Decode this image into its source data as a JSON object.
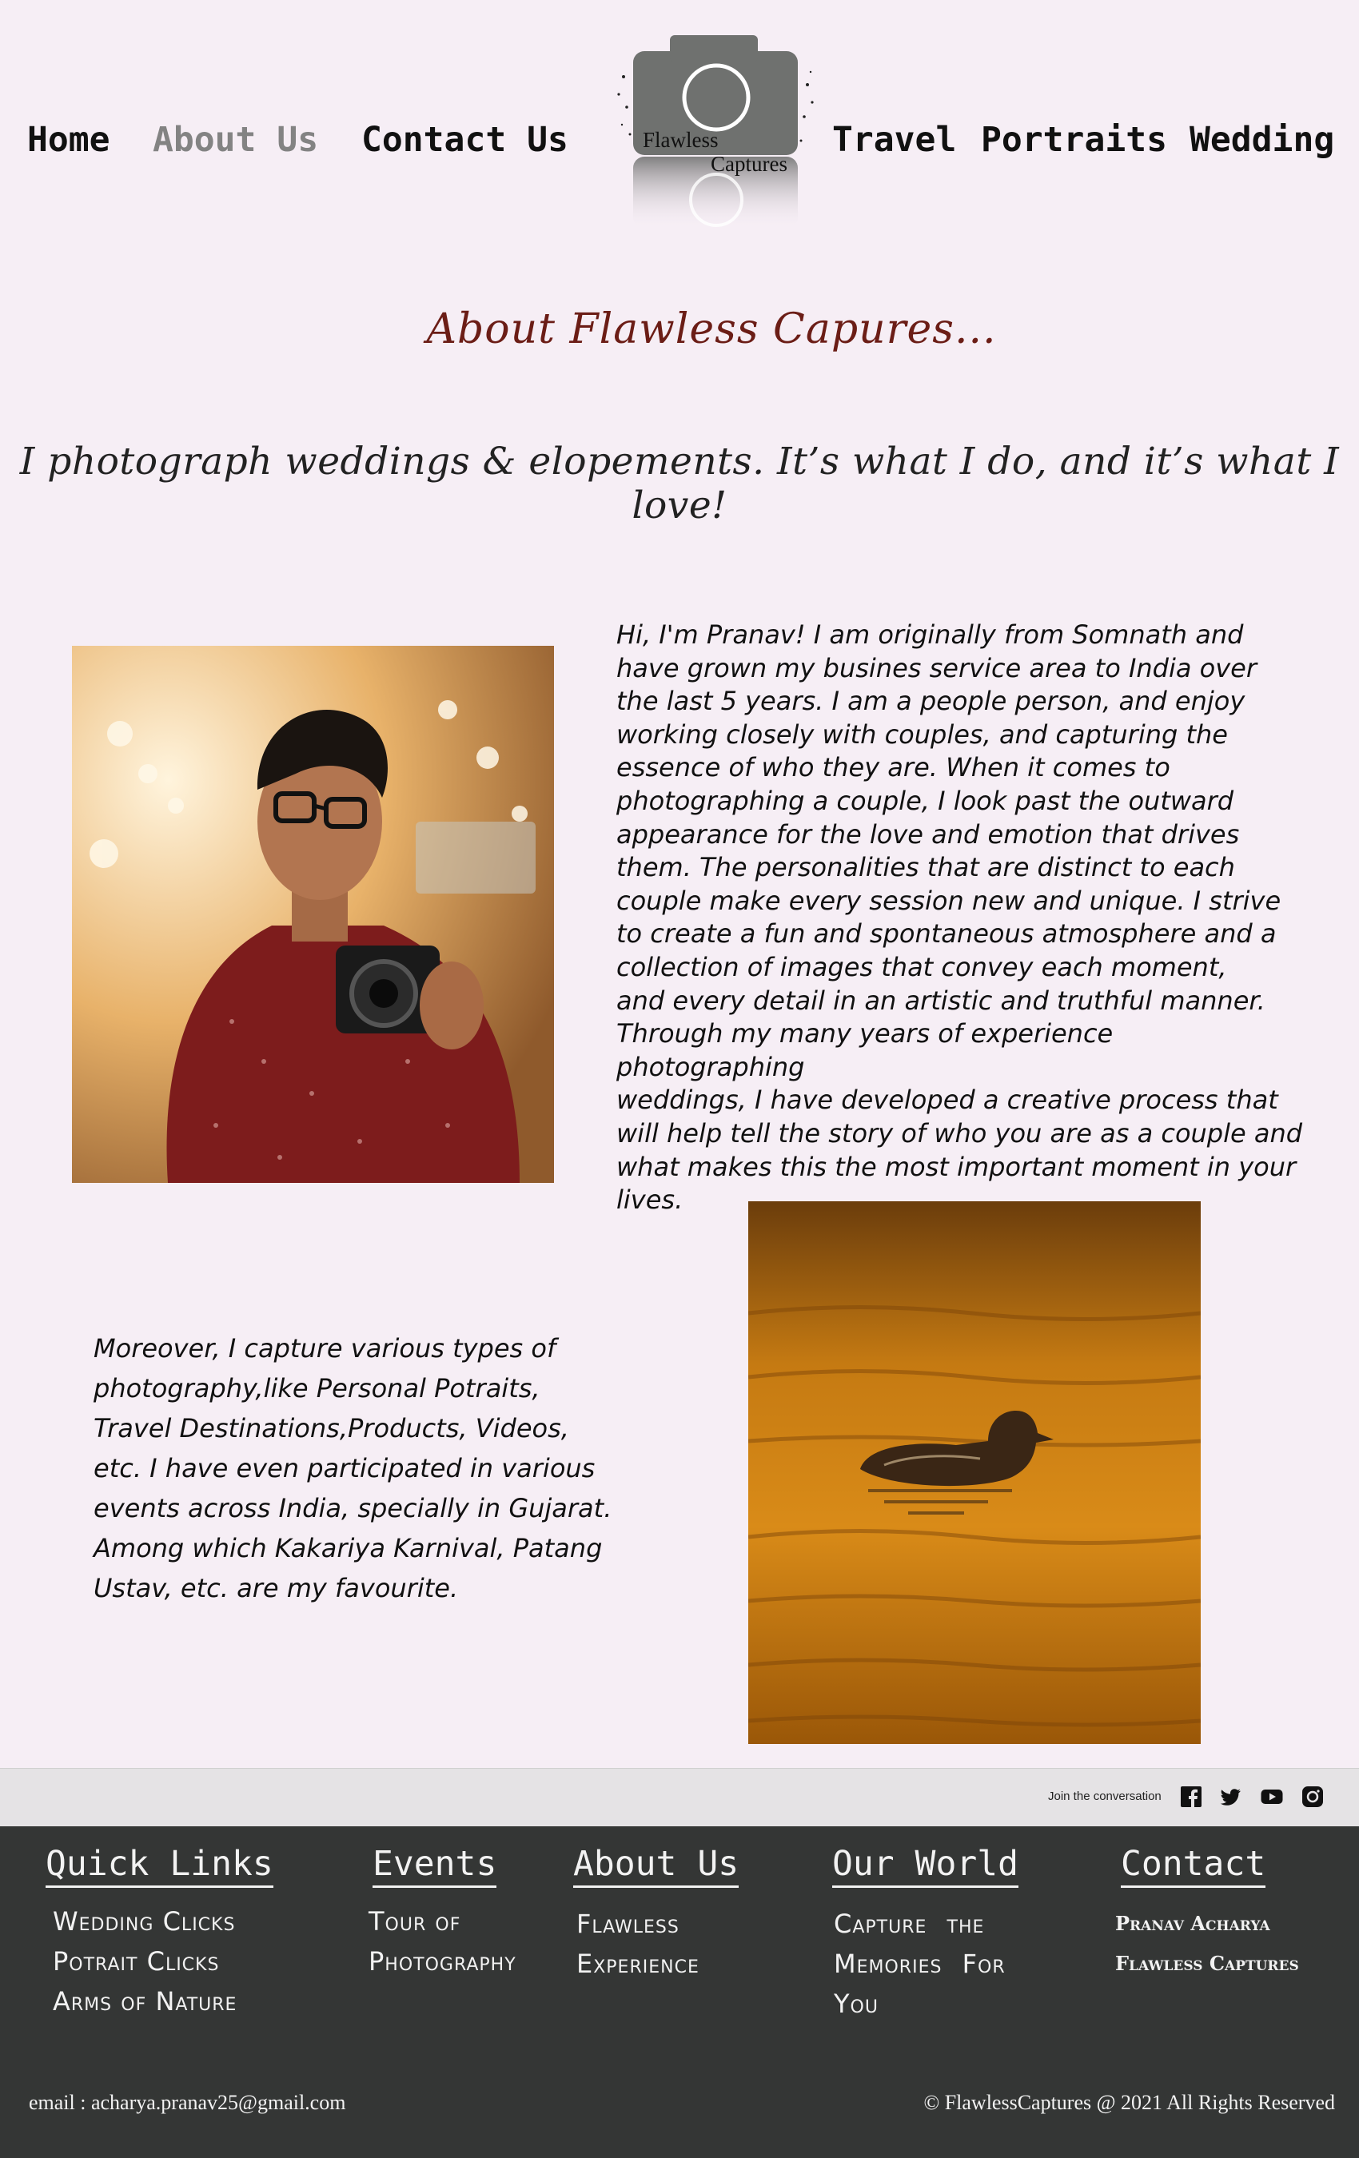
{
  "nav": {
    "home": "Home",
    "about": "About Us",
    "contact": "Contact Us",
    "travel": "Travel",
    "portraits": "Portraits",
    "wedding": "Wedding"
  },
  "logo": {
    "line1": "Flawless",
    "line2": "Captures"
  },
  "about_title": "About Flawless Capures...",
  "tagline": "I photograph weddings & elopements. It’s what I do, and it’s what I love!",
  "bio_lines": [
    "Hi, I'm Pranav! I am originally from Somnath and",
    "have grown my busines service area to India over",
    "the last 5 years. I am a people person, and enjoy",
    "working closely with couples, and capturing the",
    "essence of who they are. When it comes to",
    "photographing a couple, I look past the outward",
    "appearance for the love and emotion that drives",
    "them. The personalities that are distinct to each",
    "couple make every session new and unique. I strive",
    "to create a fun and spontaneous atmosphere and a",
    "collection of images that convey each moment,",
    "and every detail in an artistic and truthful manner.",
    "Through my many years of experience photographing",
    "weddings, I have developed a creative process that",
    "will help tell the story of who you are as a couple and",
    "what makes this the most important moment in your",
    "lives."
  ],
  "more_lines": [
    "Moreover, I capture various types of",
    "photography,like Personal Potraits,",
    "Travel Destinations,Products, Videos,",
    "etc. I have even participated in various",
    "events across India, specially in Gujarat.",
    "Among which Kakariya Karnival, Patang",
    "Ustav, etc. are my favourite."
  ],
  "social": {
    "join_text": "Join the conversation",
    "icons": [
      "facebook-icon",
      "twitter-icon",
      "youtube-icon",
      "instagram-icon"
    ]
  },
  "footer": {
    "quick_links": {
      "heading": "Quick Links",
      "items": [
        "Wedding Clicks",
        "Potrait Clicks",
        "Arms of Nature"
      ]
    },
    "events": {
      "heading": "Events",
      "lines": [
        "Tour of",
        "Photography"
      ]
    },
    "about": {
      "heading": "About Us",
      "lines": [
        "Flawless",
        "Experience"
      ]
    },
    "our_world": {
      "heading": "Our World",
      "lines": [
        "Capture the",
        "Memories For",
        "You"
      ]
    },
    "contact": {
      "heading": "Contact",
      "lines": [
        "Pranav Acharya",
        "Flawless Captures"
      ]
    },
    "email": "email : acharya.pranav25@gmail.com",
    "copyright": "© FlawlessCaptures @ 2021 All Rights Reserved"
  },
  "colors": {
    "page_bg": "#f6eef5",
    "title": "#6b1d16",
    "nav_active": "#838383",
    "footer_bg": "#343635",
    "social_bar_bg": "#e5e3e5"
  }
}
